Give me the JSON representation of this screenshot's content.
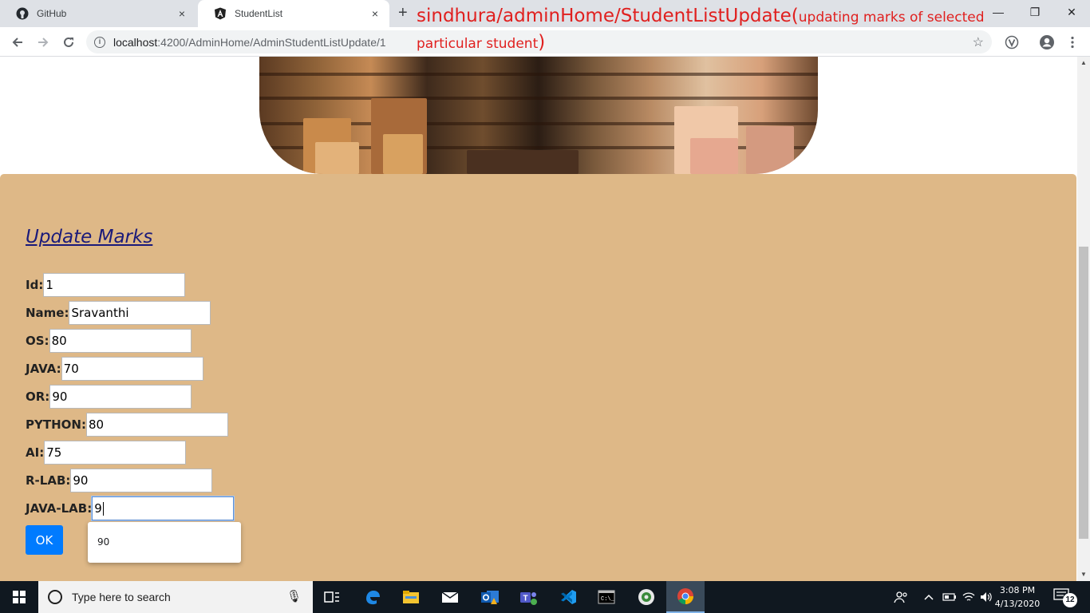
{
  "browser": {
    "tabs": [
      {
        "title": "GitHub",
        "icon": "github-icon",
        "close": "×"
      },
      {
        "title": "StudentList",
        "icon": "angular-icon",
        "close": "×"
      }
    ],
    "new_tab": "+",
    "url_host": "localhost",
    "url_rest": ":4200/AdminHome/AdminStudentListUpdate/1",
    "window_controls": {
      "minimize": "—",
      "restore": "❐",
      "close": "✕"
    }
  },
  "annotation": {
    "line1_big": "sindhura/adminHome/StudentListUpdate(",
    "line1_small": "updating marks of selected",
    "line2_small": "particular student",
    "line2_big": ")"
  },
  "form": {
    "title": "Update Marks",
    "fields": [
      {
        "label": "Id:",
        "value": "1"
      },
      {
        "label": "Name:",
        "value": "Sravanthi"
      },
      {
        "label": "OS:",
        "value": "80"
      },
      {
        "label": "JAVA:",
        "value": "70"
      },
      {
        "label": "OR:",
        "value": "90"
      },
      {
        "label": "PYTHON:",
        "value": "80"
      },
      {
        "label": "AI:",
        "value": "75"
      },
      {
        "label": "R-LAB:",
        "value": "90"
      },
      {
        "label": "JAVA-LAB:",
        "value": "9"
      }
    ],
    "submit_label": "OK",
    "autocomplete_suggestion": "90"
  },
  "colors": {
    "panel": "#deb887",
    "button": "#007bff",
    "heading": "#1a1a7a",
    "annotation": "#e0201f"
  },
  "taskbar": {
    "search_placeholder": "Type here to search",
    "time": "3:08 PM",
    "date": "4/13/2020",
    "notification_count": "12"
  }
}
